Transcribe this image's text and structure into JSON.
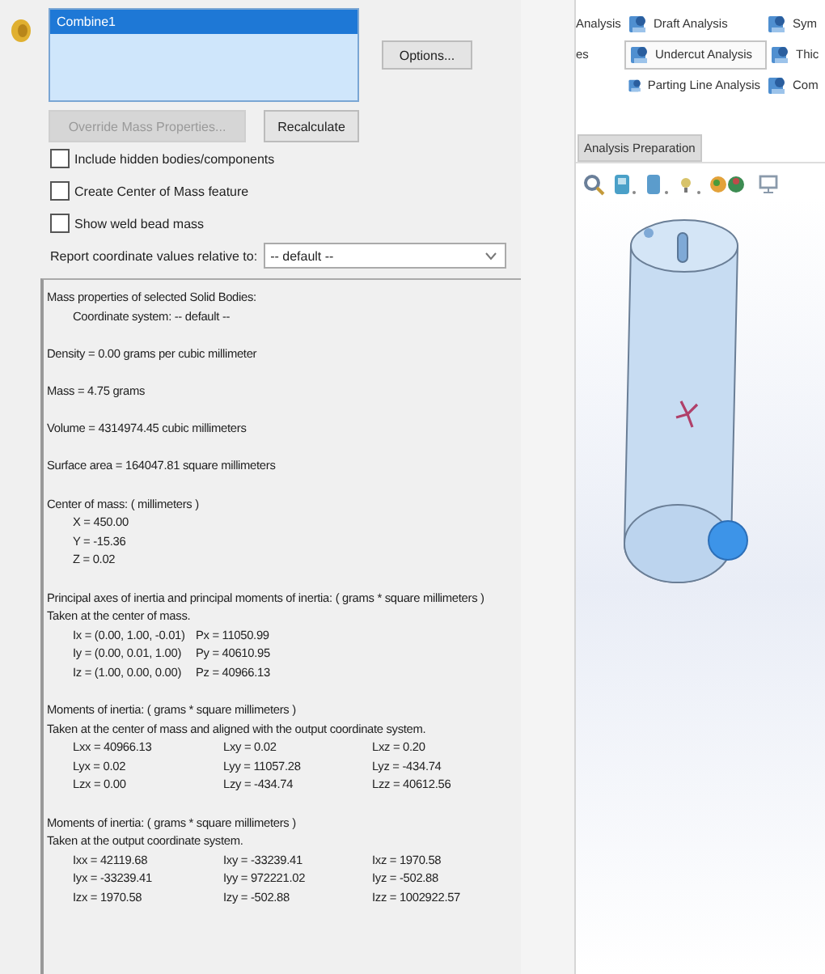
{
  "selection_list": {
    "items": [
      {
        "label": "Combine1",
        "selected": true
      }
    ]
  },
  "options_button": {
    "label": "Options..."
  },
  "action_buttons": [
    {
      "label": "Override Mass Properties...",
      "disabled": true
    },
    {
      "label": "Recalculate",
      "disabled": false
    }
  ],
  "checkboxes": [
    {
      "label": "Include hidden bodies/components",
      "checked": false
    },
    {
      "label": "Create Center of Mass feature",
      "checked": false
    },
    {
      "label": "Show weld bead mass",
      "checked": false
    }
  ],
  "report_relative": {
    "label": "Report coordinate values relative to:",
    "value": "-- default --"
  },
  "results": {
    "sections": [
      {
        "lines": [
          {
            "kind": "text",
            "text": "Mass properties of selected Solid Bodies:"
          },
          {
            "kind": "indented",
            "text": "Coordinate system: -- default --"
          }
        ]
      },
      {
        "lines": [
          {
            "kind": "text",
            "text": "Density = 0.00 grams per cubic millimeter"
          }
        ]
      },
      {
        "lines": [
          {
            "kind": "text",
            "text": "Mass = 4.75 grams"
          }
        ]
      },
      {
        "lines": [
          {
            "kind": "text",
            "text": "Volume = 4314974.45 cubic millimeters"
          }
        ]
      },
      {
        "lines": [
          {
            "kind": "text",
            "text": "Surface area = 164047.81  square millimeters"
          }
        ]
      },
      {
        "lines": [
          {
            "kind": "text",
            "text": "Center of mass: ( millimeters )"
          },
          {
            "kind": "indented",
            "text": "X = 450.00"
          },
          {
            "kind": "indented",
            "text": "Y = -15.36"
          },
          {
            "kind": "indented",
            "text": "Z = 0.02"
          }
        ]
      },
      {
        "lines": [
          {
            "kind": "text",
            "text": "Principal axes of inertia and principal moments of inertia: ( grams *  square millimeters )"
          },
          {
            "kind": "text",
            "text": "Taken at the center of mass."
          },
          {
            "kind": "columns",
            "cells": [
              "Ix = (0.00, 1.00, -0.01)",
              "Px = 11050.99"
            ]
          },
          {
            "kind": "columns",
            "cells": [
              "Iy = (0.00, 0.01, 1.00)",
              "Py = 40610.95"
            ]
          },
          {
            "kind": "columns",
            "cells": [
              "Iz = (1.00, 0.00, 0.00)",
              "Pz = 40966.13"
            ]
          }
        ]
      },
      {
        "lines": [
          {
            "kind": "text",
            "text": "Moments of inertia: ( grams *  square millimeters )"
          },
          {
            "kind": "text",
            "text": "Taken at the center of mass and aligned with the output coordinate system."
          },
          {
            "kind": "columns",
            "cells": [
              "Lxx = 40966.13",
              "Lxy = 0.02",
              "Lxz = 0.20"
            ]
          },
          {
            "kind": "columns",
            "cells": [
              "Lyx = 0.02",
              "Lyy = 11057.28",
              "Lyz = -434.74"
            ]
          },
          {
            "kind": "columns",
            "cells": [
              "Lzx = 0.00",
              "Lzy = -434.74",
              "Lzz = 40612.56"
            ]
          }
        ]
      },
      {
        "lines": [
          {
            "kind": "text",
            "text": "Moments of inertia: ( grams *  square millimeters )"
          },
          {
            "kind": "text",
            "text": "Taken at the output coordinate system."
          },
          {
            "kind": "columns",
            "cells": [
              "Ixx = 42119.68",
              "Ixy = -33239.41",
              "Ixz = 1970.58"
            ]
          },
          {
            "kind": "columns",
            "cells": [
              "Iyx = -33239.41",
              "Iyy = 972221.02",
              "Iyz = -502.88"
            ]
          },
          {
            "kind": "columns",
            "cells": [
              "Izx = 1970.58",
              "Izy = -502.88",
              "Izz = 1002922.57"
            ]
          }
        ]
      }
    ]
  },
  "ribbon": {
    "rows": [
      {
        "lead": "Analysis",
        "tools": [
          {
            "label": "Draft Analysis",
            "selected": false
          },
          {
            "label": "Sym",
            "selected": false
          }
        ]
      },
      {
        "lead": "es",
        "tools": [
          {
            "label": "Undercut Analysis",
            "selected": true
          },
          {
            "label": "Thic",
            "selected": false
          }
        ]
      },
      {
        "lead": "",
        "tools": [
          {
            "label": "Parting Line Analysis",
            "selected": false
          },
          {
            "label": "Com",
            "selected": false
          }
        ]
      }
    ]
  },
  "tabs": [
    {
      "label": "Analysis Preparation",
      "selected": true
    }
  ]
}
